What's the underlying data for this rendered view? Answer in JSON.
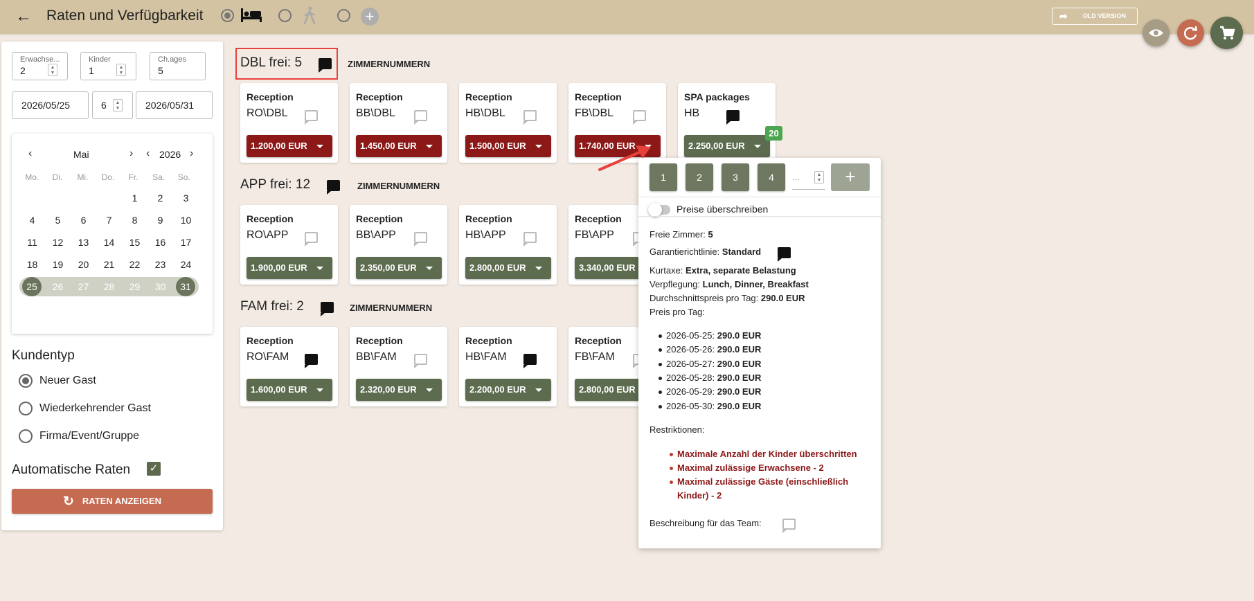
{
  "header": {
    "title": "Raten und Verfügbarkeit",
    "old_version_label": "OLD VERSION"
  },
  "search": {
    "adults_label": "Erwachse...",
    "adults_value": "2",
    "children_label": "Kinder",
    "children_value": "1",
    "ages_label": "Ch.ages",
    "ages_value": "5",
    "date_from": "2026/05/25",
    "nights": "6",
    "date_to": "2026/05/31"
  },
  "calendar": {
    "month": "Mai",
    "year": "2026",
    "weekdays": [
      "Mo.",
      "Di.",
      "Mi.",
      "Do.",
      "Fr.",
      "Sa.",
      "So."
    ],
    "leading_blanks": 4,
    "days": [
      "1",
      "2",
      "3",
      "4",
      "5",
      "6",
      "7",
      "8",
      "9",
      "10",
      "11",
      "12",
      "13",
      "14",
      "15",
      "16",
      "17",
      "18",
      "19",
      "20",
      "21",
      "22",
      "23",
      "24",
      "25",
      "26",
      "27",
      "28",
      "29",
      "30",
      "31"
    ],
    "range_start": 25,
    "range_end": 31
  },
  "customer": {
    "title": "Kundentyp",
    "options": [
      "Neuer Gast",
      "Wiederkehrender Gast",
      "Firma/Event/Gruppe"
    ],
    "selected_index": 0
  },
  "auto_rates": {
    "label": "Automatische Raten",
    "checked": true
  },
  "rates_button_label": "RATEN ANZEIGEN",
  "room_number_label": "ZIMMERNUMMERN",
  "groups": [
    {
      "title": "DBL frei: 5",
      "cards": [
        {
          "title": "Reception",
          "code": "RO\\DBL",
          "note": "outline",
          "price": "1.200,00 EUR",
          "color": "red"
        },
        {
          "title": "Reception",
          "code": "BB\\DBL",
          "note": "outline",
          "price": "1.450,00 EUR",
          "color": "red"
        },
        {
          "title": "Reception",
          "code": "HB\\DBL",
          "note": "outline",
          "price": "1.500,00 EUR",
          "color": "red"
        },
        {
          "title": "Reception",
          "code": "FB\\DBL",
          "note": "outline",
          "price": "1.740,00 EUR",
          "color": "red"
        },
        {
          "title": "SPA packages",
          "code": "HB",
          "note": "filled",
          "price": "2.250,00 EUR",
          "color": "green",
          "badge": "20"
        }
      ]
    },
    {
      "title": "APP frei: 12",
      "cards": [
        {
          "title": "Reception",
          "code": "RO\\APP",
          "note": "outline",
          "price": "1.900,00 EUR",
          "color": "green"
        },
        {
          "title": "Reception",
          "code": "BB\\APP",
          "note": "outline",
          "price": "2.350,00 EUR",
          "color": "green"
        },
        {
          "title": "Reception",
          "code": "HB\\APP",
          "note": "outline",
          "price": "2.800,00 EUR",
          "color": "green"
        },
        {
          "title": "Reception",
          "code": "FB\\APP",
          "note": "outline",
          "price": "3.340,00 EUR",
          "color": "green"
        }
      ]
    },
    {
      "title": "FAM frei: 2",
      "cards": [
        {
          "title": "Reception",
          "code": "RO\\FAM",
          "note": "filled",
          "price": "1.600,00 EUR",
          "color": "green"
        },
        {
          "title": "Reception",
          "code": "BB\\FAM",
          "note": "outline",
          "price": "2.320,00 EUR",
          "color": "green"
        },
        {
          "title": "Reception",
          "code": "HB\\FAM",
          "note": "filled",
          "price": "2.200,00 EUR",
          "color": "green"
        },
        {
          "title": "Reception",
          "code": "FB\\FAM",
          "note": "outline",
          "price": "2.800,00 EUR",
          "color": "green"
        }
      ]
    }
  ],
  "popup": {
    "qty_buttons": [
      "1",
      "2",
      "3",
      "4"
    ],
    "qty_placeholder": "...",
    "override_label": "Preise überschreiben",
    "free_rooms_label": "Freie Zimmer:",
    "free_rooms_value": "5",
    "guarantee_label": "Garantierichtlinie:",
    "guarantee_value": "Standard",
    "tax_label": "Kurtaxe:",
    "tax_value": "Extra, separate Belastung",
    "board_label": "Verpflegung:",
    "board_value": "Lunch, Dinner, Breakfast",
    "avg_label": "Durchschnittspreis pro Tag:",
    "avg_value": "290.0 EUR",
    "per_day_label": "Preis pro Tag:",
    "per_day": [
      {
        "date": "2026-05-25:",
        "price": "290.0 EUR"
      },
      {
        "date": "2026-05-26:",
        "price": "290.0 EUR"
      },
      {
        "date": "2026-05-27:",
        "price": "290.0 EUR"
      },
      {
        "date": "2026-05-28:",
        "price": "290.0 EUR"
      },
      {
        "date": "2026-05-29:",
        "price": "290.0 EUR"
      },
      {
        "date": "2026-05-30:",
        "price": "290.0 EUR"
      }
    ],
    "restrictions_label": "Restriktionen:",
    "restrictions": [
      "Maximale Anzahl der Kinder überschritten",
      "Maximal zulässige Erwachsene - 2",
      "Maximal zulässige Gäste (einschließlich Kinder) - 2"
    ],
    "team_desc_label": "Beschreibung für das Team:"
  },
  "colors": {
    "topbar": "#d3c3a2",
    "background": "#f3ebe3",
    "price_red": "#8c1818",
    "price_green": "#5d6b4f",
    "accent_orange": "#c56b51",
    "badge_green": "#4ca550"
  },
  "icons": [
    "back-arrow-icon",
    "bed-icon",
    "walking-person-icon",
    "plus-icon",
    "eye-icon",
    "refresh-icon",
    "cart-icon",
    "message-icon",
    "calendar-chevron-icon"
  ]
}
